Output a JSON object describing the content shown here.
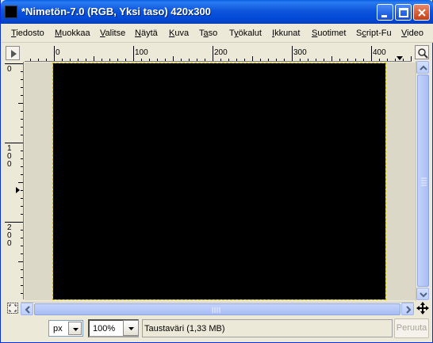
{
  "window": {
    "title": "*Nimetön-7.0 (RGB, Yksi taso) 420x300",
    "icon": "image-icon"
  },
  "menubar": {
    "items": [
      {
        "label": "Tiedosto",
        "accel": "T"
      },
      {
        "label": "Muokkaa",
        "accel": "M"
      },
      {
        "label": "Valitse",
        "accel": "V"
      },
      {
        "label": "Näytä",
        "accel": "N"
      },
      {
        "label": "Kuva",
        "accel": "K"
      },
      {
        "label": "Taso",
        "accel": "a"
      },
      {
        "label": "Työkalut",
        "accel": "y"
      },
      {
        "label": "Ikkunat",
        "accel": "I"
      },
      {
        "label": "Suotimet",
        "accel": "S"
      },
      {
        "label": "Script-Fu",
        "accel": "c"
      },
      {
        "label": "Video",
        "accel": "V"
      }
    ]
  },
  "rulers": {
    "horizontal_labels": [
      "0",
      "100",
      "200",
      "300",
      "400"
    ],
    "vertical_labels": [
      "0",
      "100",
      "200"
    ]
  },
  "canvas": {
    "fill_color": "#000000",
    "image_width": 420,
    "image_height": 300
  },
  "statusbar": {
    "unit": "px",
    "zoom": "100%",
    "message": "Taustaväri (1,33 MB)",
    "cancel_label": "Peruuta"
  },
  "colors": {
    "titlebar": "#0049d6",
    "window_bg": "#ece9d8",
    "close_button": "#d65a33"
  }
}
